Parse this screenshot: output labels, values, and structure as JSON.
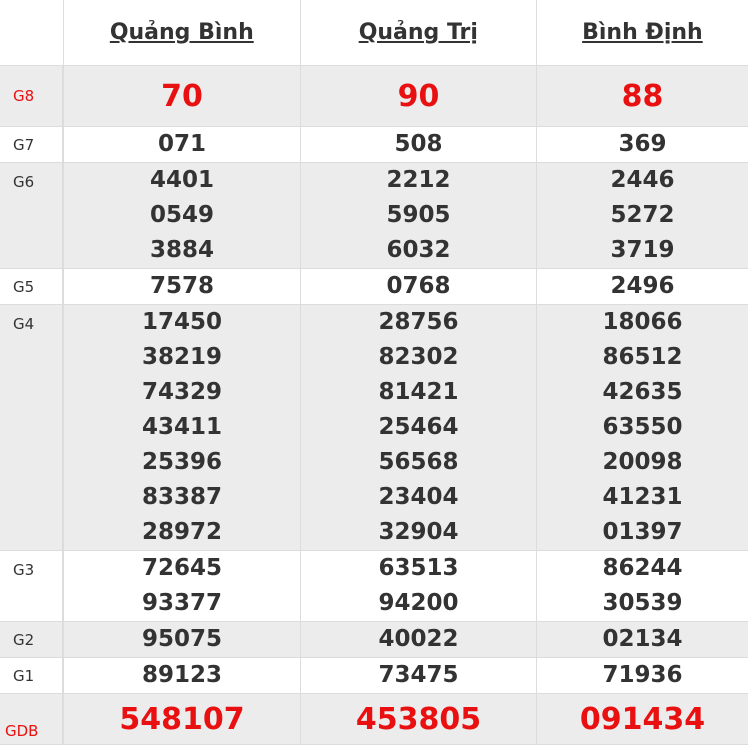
{
  "columns": [
    "Quảng Bình",
    "Quảng Trị",
    "Bình Định"
  ],
  "rows": [
    {
      "label": "G8",
      "values": [
        [
          "70"
        ],
        [
          "90"
        ],
        [
          "88"
        ]
      ]
    },
    {
      "label": "G7",
      "values": [
        [
          "071"
        ],
        [
          "508"
        ],
        [
          "369"
        ]
      ]
    },
    {
      "label": "G6",
      "values": [
        [
          "4401",
          "0549",
          "3884"
        ],
        [
          "2212",
          "5905",
          "6032"
        ],
        [
          "2446",
          "5272",
          "3719"
        ]
      ]
    },
    {
      "label": "G5",
      "values": [
        [
          "7578"
        ],
        [
          "0768"
        ],
        [
          "2496"
        ]
      ]
    },
    {
      "label": "G4",
      "values": [
        [
          "17450",
          "38219",
          "74329",
          "43411",
          "25396",
          "83387",
          "28972"
        ],
        [
          "28756",
          "82302",
          "81421",
          "25464",
          "56568",
          "23404",
          "32904"
        ],
        [
          "18066",
          "86512",
          "42635",
          "63550",
          "20098",
          "41231",
          "01397"
        ]
      ]
    },
    {
      "label": "G3",
      "values": [
        [
          "72645",
          "93377"
        ],
        [
          "63513",
          "94200"
        ],
        [
          "86244",
          "30539"
        ]
      ]
    },
    {
      "label": "G2",
      "values": [
        [
          "95075"
        ],
        [
          "40022"
        ],
        [
          "02134"
        ]
      ]
    },
    {
      "label": "G1",
      "values": [
        [
          "89123"
        ],
        [
          "73475"
        ],
        [
          "71936"
        ]
      ]
    },
    {
      "label": "GDB",
      "values": [
        [
          "548107"
        ],
        [
          "453805"
        ],
        [
          "091434"
        ]
      ]
    }
  ],
  "colors": {
    "highlight": "#e81010",
    "text": "#333333",
    "stripe": "#ececec"
  }
}
